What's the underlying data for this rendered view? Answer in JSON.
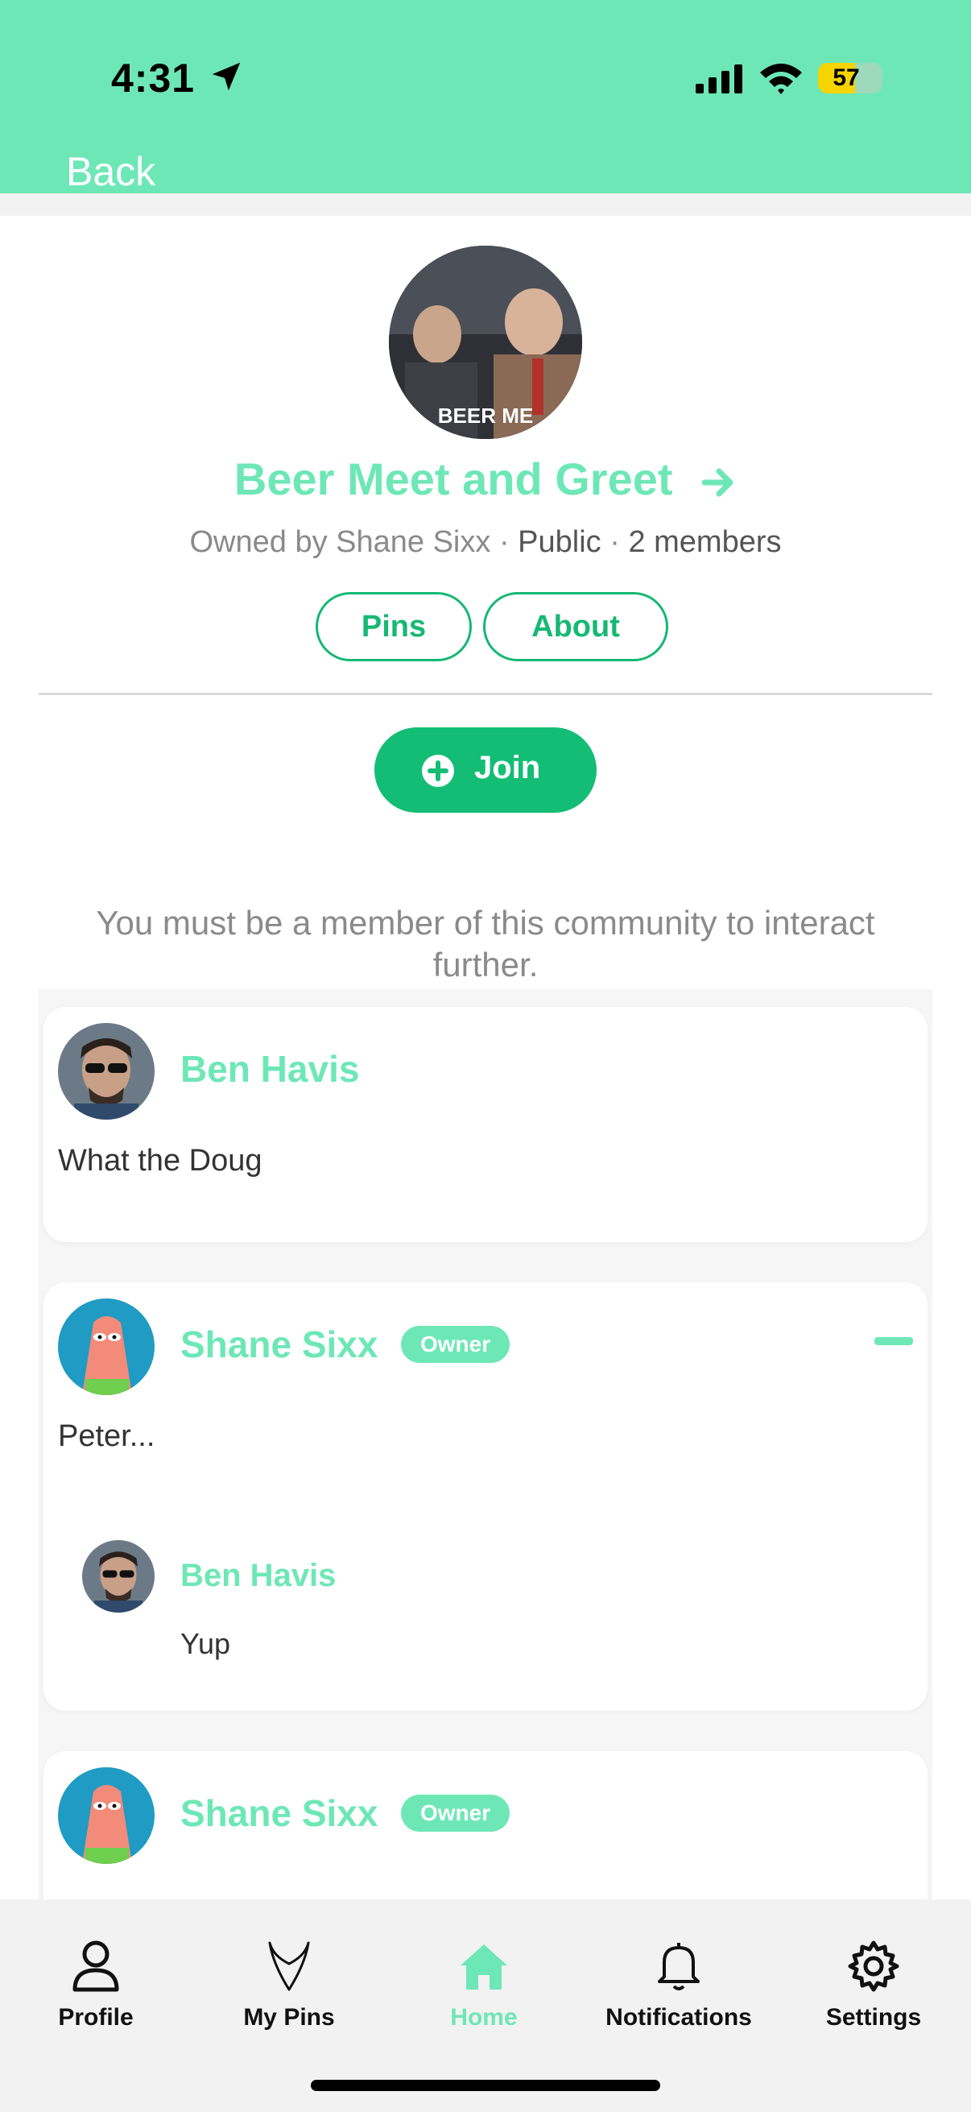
{
  "status_bar": {
    "time": "4:31",
    "battery": "57",
    "battery_level": 0.57,
    "battery_color": "#f5d400"
  },
  "header": {
    "back_label": "Back",
    "color": "#6ee7b7"
  },
  "community": {
    "avatar_caption": "BEER ME",
    "title": "Beer Meet and Greet",
    "owned_by": "Owned by Shane Sixx",
    "separator": "·",
    "visibility": "Public",
    "members": "2 members",
    "tabs": [
      {
        "label": "Pins"
      },
      {
        "label": "About"
      }
    ],
    "join_label": "Join",
    "member_note": "You must be a member of this community to interact further."
  },
  "posts": [
    {
      "author": "Ben Havis",
      "text": "What the Doug",
      "avatar_icon": "person-sunglasses-avatar"
    },
    {
      "author": "Shane Sixx",
      "badge": "Owner",
      "text": "Peter...",
      "avatar_icon": "cartoon-character-avatar",
      "replies": [
        {
          "author": "Ben Havis",
          "text": "Yup"
        }
      ]
    },
    {
      "author": "Shane Sixx",
      "badge": "Owner",
      "avatar_icon": "cartoon-character-avatar"
    }
  ],
  "tabbar": {
    "items": [
      {
        "label": "Profile",
        "icon": "person-icon"
      },
      {
        "label": "My Pins",
        "icon": "pin-icon"
      },
      {
        "label": "Home",
        "icon": "home-icon",
        "active": true
      },
      {
        "label": "Notifications",
        "icon": "bell-icon"
      },
      {
        "label": "Settings",
        "icon": "gear-icon"
      }
    ]
  },
  "colors": {
    "accent": "#6ee7b7",
    "button": "#14bd76"
  }
}
